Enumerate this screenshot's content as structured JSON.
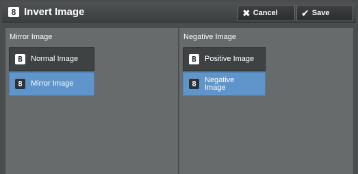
{
  "header": {
    "title": "Invert Image",
    "icon_glyph": "8",
    "cancel_label": "Cancel",
    "save_label": "Save"
  },
  "mirror_panel": {
    "title": "Mirror Image",
    "options": [
      {
        "label": "Normal Image",
        "glyph": "B",
        "selected": false
      },
      {
        "label": "Mirror Image",
        "glyph": "8",
        "selected": true
      }
    ]
  },
  "negative_panel": {
    "title": "Negative Image",
    "options": [
      {
        "label": "Positive Image",
        "glyph": "B",
        "selected": false
      },
      {
        "label_line1": "Negative",
        "label_line2": "Image",
        "glyph": "8",
        "selected": true
      }
    ]
  },
  "colors": {
    "background": "#4a4d4e",
    "panel": "#676b6b",
    "selected": "#5f95cb",
    "unselected": "#3f4243"
  }
}
